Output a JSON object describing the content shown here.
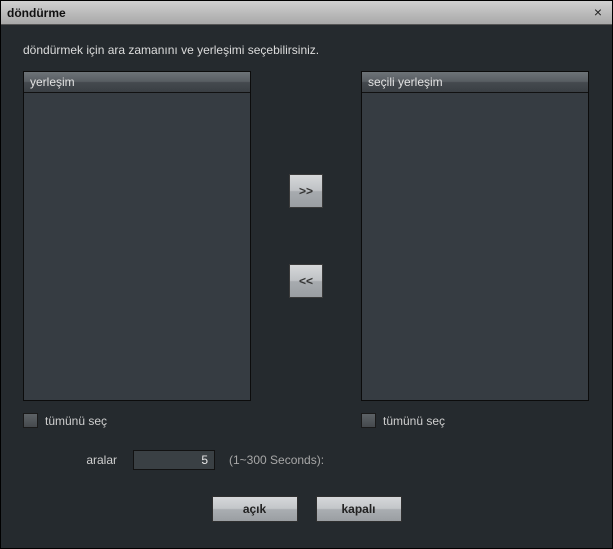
{
  "window": {
    "title": "döndürme",
    "close_glyph": "×"
  },
  "instruction": "döndürmek için ara zamanını ve yerleşimi seçebilirsiniz.",
  "left_list": {
    "header": "yerleşim",
    "select_all_label": "tümünü seç"
  },
  "right_list": {
    "header": "seçili yerleşim",
    "select_all_label": "tümünü seç"
  },
  "transfer": {
    "add_label": ">>",
    "remove_label": "<<"
  },
  "interval": {
    "label": "aralar",
    "value": "5",
    "hint": "(1~300 Seconds):"
  },
  "buttons": {
    "open": "açık",
    "close": "kapalı"
  }
}
